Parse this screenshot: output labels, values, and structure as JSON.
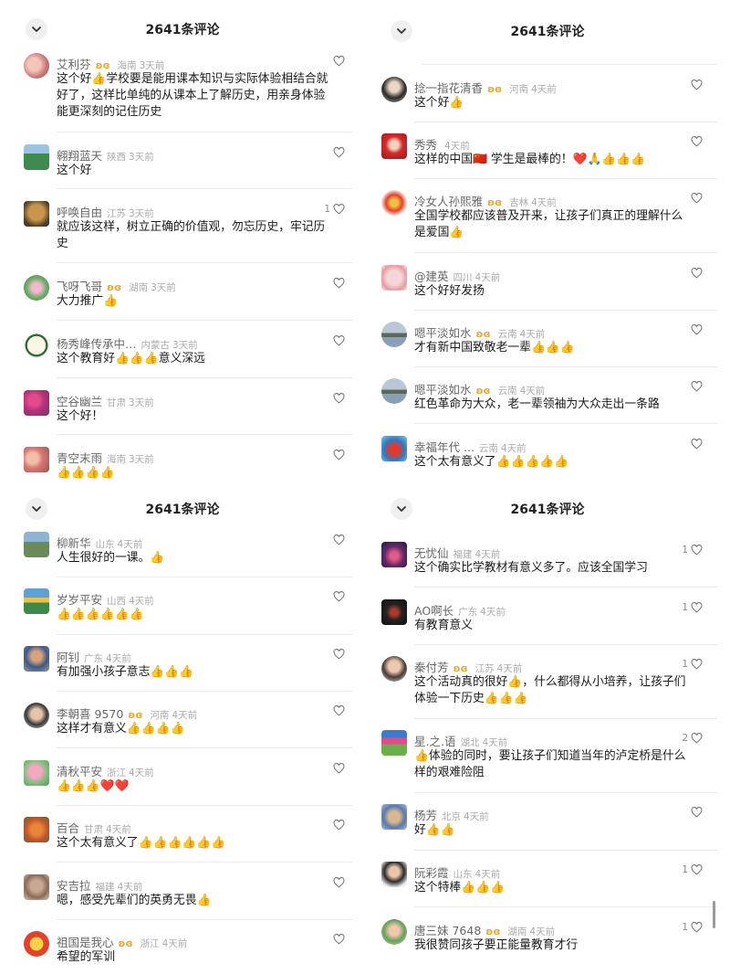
{
  "header_title": "2641条评论",
  "panels": [
    {
      "comments": [
        {
          "user": "艾利芬",
          "vip": true,
          "loc": "海南",
          "time": "3天前",
          "text": "这个好👍学校要是能用课本知识与实际体验相结合就好了，这样比单纯的从课本上了解历史，用亲身体验能更深刻的记住历史",
          "likes": ""
        },
        {
          "user": "翱翔蓝天",
          "vip": false,
          "loc": "陕西",
          "time": "3天前",
          "text": "这个好",
          "likes": ""
        },
        {
          "user": "呼唤自由",
          "vip": false,
          "loc": "江苏",
          "time": "3天前",
          "text": "就应该这样，树立正确的价值观，勿忘历史，牢记历史",
          "likes": "1"
        },
        {
          "user": "飞呀飞哥",
          "vip": true,
          "loc": "湖南",
          "time": "3天前",
          "text": "大力推广👍",
          "likes": ""
        },
        {
          "user": "杨秀峰传承中…",
          "vip": false,
          "loc": "内蒙古",
          "time": "3天前",
          "text": "这个教育好👍👍👍意义深远",
          "likes": ""
        },
        {
          "user": "空谷幽兰",
          "vip": false,
          "loc": "甘肃",
          "time": "3天前",
          "text": "这个好！",
          "likes": ""
        },
        {
          "user": "青空末雨",
          "vip": false,
          "loc": "海南",
          "time": "3天前",
          "text": "👍👍👍👍",
          "likes": ""
        }
      ]
    },
    {
      "comments": [
        {
          "user": "捻一指花清香",
          "vip": true,
          "loc": "河南",
          "time": "4天前",
          "text": "这个好👍",
          "likes": ""
        },
        {
          "user": "秀秀",
          "vip": false,
          "loc": "",
          "time": "4天前",
          "text": "这样的中国🇨🇳 学生是最棒的！❤️🙏👍👍👍",
          "likes": ""
        },
        {
          "user": "冷女人孙熙雅",
          "vip": true,
          "loc": "吉林",
          "time": "4天前",
          "text": "全国学校都应该普及开来，让孩子们真正的理解什么是爱国👍",
          "likes": ""
        },
        {
          "user": "@建英",
          "vip": false,
          "loc": "四川",
          "time": "4天前",
          "text": "这个好好发扬",
          "likes": ""
        },
        {
          "user": "嗯平淡如水",
          "vip": true,
          "loc": "云南",
          "time": "4天前",
          "text": "才有新中国致敬老一辈👍👍👍",
          "likes": ""
        },
        {
          "user": "嗯平淡如水",
          "vip": true,
          "loc": "云南",
          "time": "4天前",
          "text": "红色革命为大众，老一辈领袖为大众走出一条路",
          "likes": ""
        },
        {
          "user": "幸福年代 ...",
          "vip": false,
          "loc": "云南",
          "time": "4天前",
          "text": "这个太有意义了👍👍👍👍👍",
          "likes": ""
        }
      ]
    },
    {
      "comments": [
        {
          "user": "柳新华",
          "vip": false,
          "loc": "山东",
          "time": "4天前",
          "text": "人生很好的一课。👍",
          "likes": ""
        },
        {
          "user": "岁岁平安",
          "vip": false,
          "loc": "山西",
          "time": "4天前",
          "text": "👍👍👍👍👍👍",
          "likes": ""
        },
        {
          "user": "阿钊",
          "vip": false,
          "loc": "广东",
          "time": "4天前",
          "text": "有加强小孩子意志👍👍👍",
          "likes": ""
        },
        {
          "user": "李朝喜 9570",
          "vip": true,
          "loc": "河南",
          "time": "4天前",
          "text": "这样才有意义👍👍👍👍",
          "likes": ""
        },
        {
          "user": "清秋平安",
          "vip": false,
          "loc": "浙江",
          "time": "4天前",
          "text": "👍👍👍❤️❤️",
          "likes": ""
        },
        {
          "user": "百合",
          "vip": false,
          "loc": "甘肃",
          "time": "4天前",
          "text": "这个太有意义了👍👍👍👍👍👍",
          "likes": ""
        },
        {
          "user": "安吉拉",
          "vip": false,
          "loc": "福建",
          "time": "4天前",
          "text": "嗯，感受先辈们的英勇无畏👍",
          "likes": ""
        },
        {
          "user": "祖国是我心",
          "vip": true,
          "loc": "浙江",
          "time": "4天前",
          "text": "希望的军训",
          "likes": ""
        }
      ]
    },
    {
      "comments": [
        {
          "user": "无忧仙",
          "vip": false,
          "loc": "福建",
          "time": "4天前",
          "text": "这个确实比学教材有意义多了。应该全国学习",
          "likes": "1"
        },
        {
          "user": "AO啊长",
          "vip": false,
          "loc": "广东",
          "time": "4天前",
          "text": "有教育意义",
          "likes": "1"
        },
        {
          "user": "秦付芳",
          "vip": true,
          "loc": "江苏",
          "time": "4天前",
          "text": "这个活动真的很好👍，什么都得从小培养，让孩子们体验一下历史👍👍👍",
          "likes": "1"
        },
        {
          "user": "星.之.语",
          "vip": false,
          "loc": "湖北",
          "time": "4天前",
          "text": "👍体验的同时，要让孩子们知道当年的泸定桥是什么样的艰难险阻",
          "likes": "2"
        },
        {
          "user": "杨芳",
          "vip": false,
          "loc": "北京",
          "time": "4天前",
          "text": "好👍👍",
          "likes": ""
        },
        {
          "user": "阮彩霞",
          "vip": false,
          "loc": "山东",
          "time": "4天前",
          "text": "这个特棒👍👍👍",
          "likes": "1"
        },
        {
          "user": "唐三妹 7648",
          "vip": true,
          "loc": "湖南",
          "time": "4天前",
          "text": "我很赞同孩子要正能量教育才行",
          "likes": "1"
        }
      ]
    }
  ]
}
